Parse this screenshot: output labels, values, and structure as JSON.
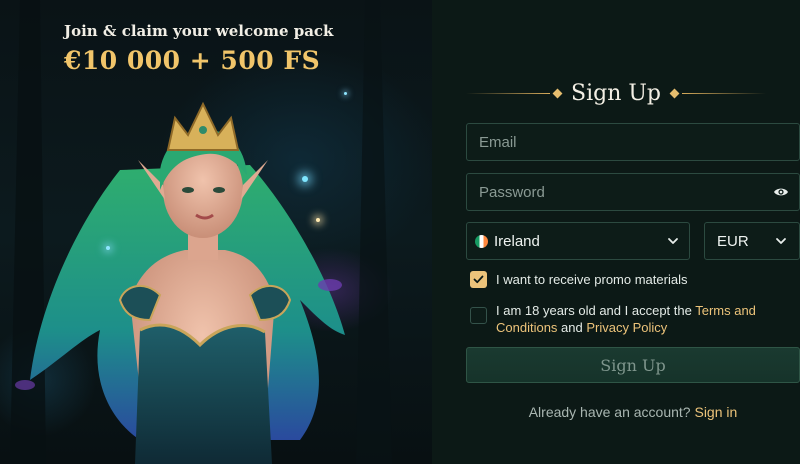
{
  "hero": {
    "subtitle": "Join & claim your welcome pack",
    "offer": "€10 000 + 500 FS"
  },
  "form": {
    "heading": "Sign Up",
    "email_placeholder": "Email",
    "password_placeholder": "Password",
    "country": "Ireland",
    "currency": "EUR",
    "promo_label": "I want to receive promo materials",
    "promo_checked": true,
    "terms_prefix": "I am 18 years old and I accept the ",
    "terms_link": "Terms and Conditions",
    "terms_and": " and ",
    "privacy_link": "Privacy Policy",
    "terms_checked": false,
    "submit_label": "Sign Up",
    "already_text": "Already have an account? ",
    "signin_link": "Sign in"
  },
  "icons": {
    "password_toggle": "eye-icon",
    "select_arrow": "chevron-down-icon",
    "checkbox_mark": "check-icon",
    "country_flag": "ireland-flag-icon"
  },
  "colors": {
    "background": "#0c1916",
    "accent_gold": "#ecc37a",
    "field_border": "#2c4a40",
    "submit_bg": "#1a3a30"
  }
}
